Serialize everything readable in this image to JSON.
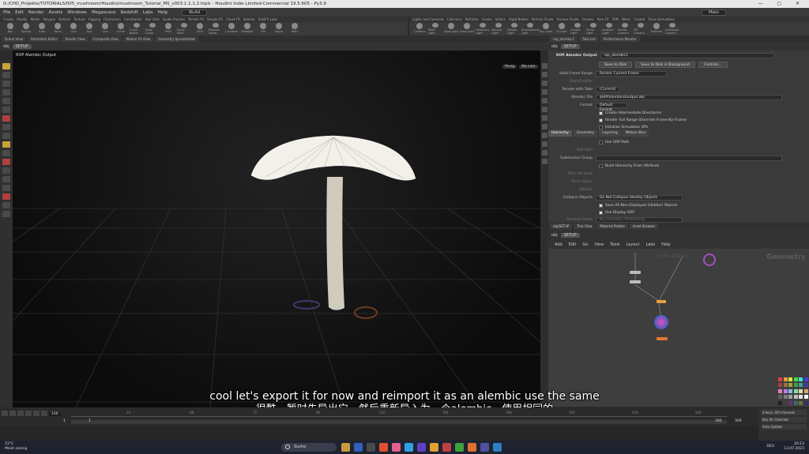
{
  "window": {
    "title": "D:/CHD_Projekte/TUTORIALS/005_mushroom/Houdini/mushroom_Tutorial_MS_v003.1.1.1.2.hiplc - Houdini Indie Limited-Commercial 19.5.605 - Py3.9",
    "controls": "— ▢ ✕"
  },
  "menubar": {
    "items": [
      "File",
      "Edit",
      "Render",
      "Assets",
      "Windows",
      "Megascans",
      "Redshift",
      "Labs",
      "Help"
    ],
    "desktop": "Build",
    "context": "Main"
  },
  "shelf": {
    "tabs_left": [
      "Create",
      "Modify",
      "Model",
      "Polygon",
      "Deform",
      "Texture",
      "Rigging",
      "Characters",
      "Constraints",
      "Hair Utils",
      "Guide Process",
      "Terrain FX",
      "Simple FX",
      "Cloud FX",
      "Volume",
      "SideFX Labs"
    ],
    "tools_left": [
      "Box",
      "Sphere",
      "Tube",
      "Torus",
      "Grid",
      "Null",
      "Line",
      "Circle",
      "Curve Bezier",
      "Draw Curve",
      "Path",
      "Spray Paint",
      "Font",
      "Platonic Solids",
      "L-System",
      "Metaball",
      "File",
      "Spiral",
      "Helix"
    ],
    "tabs_right": [
      "Lights and Cameras",
      "Collisions",
      "Particles",
      "Grains",
      "Vellum",
      "Rigid Bodies",
      "Particle Fluids",
      "Viscous Fluids",
      "Oceans",
      "Pyro FX",
      "FEM",
      "Wires",
      "Crowds",
      "Drive Simulation"
    ],
    "tools_right": [
      "Camera",
      "Point Light",
      "Spot Light",
      "Area Light",
      "Geometry Light",
      "Volume Light",
      "Distant Light",
      "Environment Light",
      "Sky Light",
      "GI Light",
      "Caustic Light",
      "Portal Light",
      "Ambient Light",
      "Stereo Camera",
      "VR Camera",
      "Switcher",
      "Gamepad Camera"
    ]
  },
  "left_pane": {
    "tabs": [
      "Scene View",
      "Animation Editor",
      "Render View",
      "Composite View",
      "Motion FX View",
      "Geometry Spreadsheet"
    ],
    "path_obj": "obj",
    "path_node": "SETUP",
    "viewport_label": "ROP Alembic Output",
    "persp_label": "Persp",
    "cam_label": "No cam"
  },
  "right_top": {
    "tabs": [
      "rop_alembic1",
      "Take List",
      "Performance Monitor"
    ],
    "path_obj": "obj",
    "path_node": "SETUP",
    "node_type": "ROP Alembic Output",
    "node_name": "rop_alembic1",
    "buttons": [
      "Save to Disk",
      "Save to Disk in Background",
      "Controls..."
    ],
    "valid_frame_range_label": "Valid Frame Range",
    "valid_frame_range_value": "Render Current Frame",
    "start_end_label": "Start/End/Inc",
    "render_with_take_label": "Render with Take",
    "render_with_take_value": "(Current)",
    "alembic_file_label": "Alembic File",
    "alembic_file_value": "$HIP/alembics/output.abc",
    "format_label": "Format",
    "format_value": "Default Format",
    "checks": [
      {
        "label": "Create Intermediate Directories",
        "on": true
      },
      {
        "label": "Render Full Range (Override Frame-By-Frame)",
        "on": true
      },
      {
        "label": "Initialize Simulation OPs",
        "on": false
      }
    ],
    "param_tabs": [
      "Hierarchy",
      "Geometry",
      "Layering",
      "Motion Blur"
    ],
    "use_sop_path": "Use SOP Path",
    "sop_path_label": "SOP Path",
    "subdivision_label": "Subdivision Group",
    "build_hierarchy": "Build Hierarchy From Attribute",
    "path_attribute_label": "Path Attribute",
    "root_object_label": "Root Object",
    "objects_label": "Objects",
    "collapse_label": "Collapse Objects",
    "collapse_value": "Do Not Collapse Identity Objects",
    "save_all_hidden": "Save All Non-Displayed (Hidden) Objects",
    "use_display_sop": "Use Display SOP",
    "partition_label": "Partition Mode",
    "partition_value": "No Geometry Partitioning"
  },
  "network": {
    "tabs": [
      "obj/SETUP",
      "Tree View",
      "Material Palette",
      "Asset Browser"
    ],
    "path_obj": "obj",
    "path_node": "SETUP",
    "menu": [
      "Add",
      "Edit",
      "Go",
      "View",
      "Tools",
      "Layout",
      "Labs",
      "Help"
    ],
    "watermark": "Geometry",
    "watermark2": "Indie Edition"
  },
  "timeline": {
    "current_frame": "100",
    "ticks": [
      "24",
      "48",
      "72",
      "96",
      "120",
      "144",
      "168",
      "192",
      "216",
      "240"
    ],
    "start_frame": "1",
    "start_frame2": "1",
    "end_frame": "300",
    "end_frame2": "300",
    "keys_label": "0 keys, 0/0 channels",
    "key_all": "Key All Channels",
    "auto_update": "Auto Update"
  },
  "subtitle": {
    "en": "cool let's export it for now and reimport it as an alembic use the same",
    "zh": "很酷，暂时先导出它，然后重新导入为一个alembic，使用相同的"
  },
  "taskbar": {
    "temp": "23°C",
    "weather": "Meist sonnig",
    "search": "Suche",
    "lang": "DEU",
    "time": "20:13",
    "date": "13.07.2023"
  },
  "colors": {
    "viewport_bg": "#0c0c0c",
    "mushroom": "#cfcbbd",
    "accent_orange": "#e8a040",
    "accent_purple": "#a050c0",
    "rop_node": "#e07830"
  }
}
